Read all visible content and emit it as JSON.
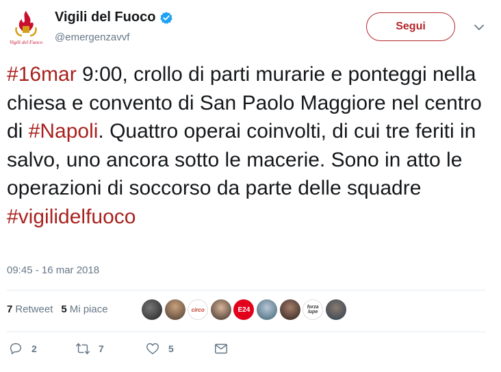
{
  "profile": {
    "display_name": "Vigili del Fuoco",
    "handle": "@emergenzavvf",
    "logo_text": "Vigili del Fuoco",
    "logo_icon": "fire-brigade-emblem",
    "verified_icon": "verified-badge-icon"
  },
  "header": {
    "follow_label": "Segui",
    "menu_icon": "chevron-down-icon"
  },
  "tweet": {
    "segments": [
      {
        "text": "#16mar",
        "hashtag": true
      },
      {
        "text": " 9:00, crollo di parti murarie e ponteggi nella chiesa e convento di San Paolo Maggiore nel centro di ",
        "hashtag": false
      },
      {
        "text": "#Napoli",
        "hashtag": true
      },
      {
        "text": ". Quattro operai coinvolti, di cui tre feriti in salvo, uno ancora sotto le macerie. Sono in atto le operazioni di soccorso da parte delle squadre ",
        "hashtag": false
      },
      {
        "text": "#vigilidelfuoco",
        "hashtag": true
      }
    ],
    "timestamp": "09:45 - 16 mar 2018"
  },
  "stats": {
    "retweet_count": "7",
    "retweet_label": "Retweet",
    "like_count": "5",
    "like_label": "Mi piace"
  },
  "likers": [
    {
      "name": "liker-avatar-1",
      "label": ""
    },
    {
      "name": "liker-avatar-2",
      "label": ""
    },
    {
      "name": "liker-avatar-3",
      "label": "circo"
    },
    {
      "name": "liker-avatar-4",
      "label": ""
    },
    {
      "name": "liker-avatar-5",
      "label": "E24"
    },
    {
      "name": "liker-avatar-6",
      "label": ""
    },
    {
      "name": "liker-avatar-7",
      "label": ""
    },
    {
      "name": "liker-avatar-8",
      "label": "forza lupe"
    },
    {
      "name": "liker-avatar-9",
      "label": ""
    }
  ],
  "actions": {
    "reply_icon": "reply-icon",
    "reply_count": "2",
    "retweet_icon": "retweet-icon",
    "retweet_count": "7",
    "like_icon": "heart-icon",
    "like_count": "5",
    "dm_icon": "envelope-icon"
  },
  "colors": {
    "hashtag": "#a8211e",
    "follow_border": "#b3262a",
    "verified": "#1da1f2",
    "muted": "#657786"
  }
}
